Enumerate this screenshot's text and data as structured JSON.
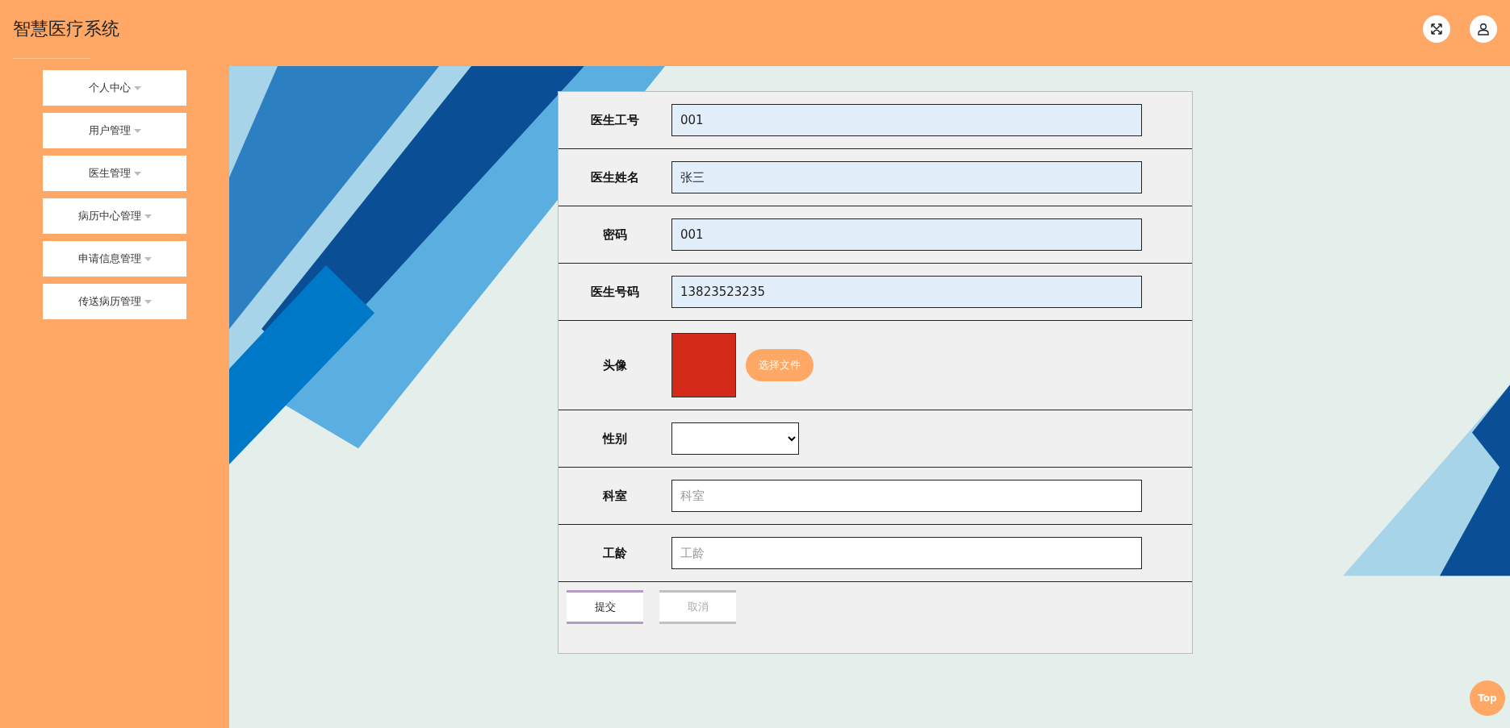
{
  "header": {
    "title": "智慧医疗系统"
  },
  "sidebar": {
    "items": [
      {
        "label": "个人中心"
      },
      {
        "label": "用户管理"
      },
      {
        "label": "医生管理"
      },
      {
        "label": "病历中心管理"
      },
      {
        "label": "申请信息管理"
      },
      {
        "label": "传送病历管理"
      }
    ]
  },
  "form": {
    "fields": [
      {
        "kind": "text",
        "label": "医生工号",
        "value": "001"
      },
      {
        "kind": "text",
        "label": "医生姓名",
        "value": "张三"
      },
      {
        "kind": "text",
        "label": "密码",
        "value": "001"
      },
      {
        "kind": "text",
        "label": "医生号码",
        "value": "13823523235"
      },
      {
        "kind": "image",
        "label": "头像",
        "button": "选择文件"
      },
      {
        "kind": "select",
        "label": "性别"
      },
      {
        "kind": "text",
        "label": "科室",
        "placeholder": "科室"
      },
      {
        "kind": "text",
        "label": "工龄",
        "placeholder": "工龄"
      }
    ],
    "buttons": [
      {
        "label": "提交",
        "disabled": false
      },
      {
        "label": "取消",
        "disabled": true
      }
    ]
  },
  "back_to_top": "Top"
}
